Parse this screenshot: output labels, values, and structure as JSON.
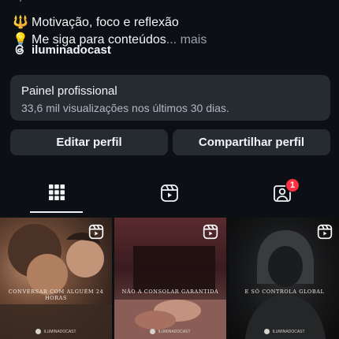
{
  "bio": {
    "line0": "⚙ — —",
    "line1_emoji": "🔱",
    "line1_text": "Motivação, foco e reflexão",
    "line2_emoji": "💡",
    "line2_text": "Me siga para conteúdos",
    "more_label": "... mais"
  },
  "threads": {
    "handle": "iluminadocast",
    "icon": "threads-icon"
  },
  "panel": {
    "title": "Painel profissional",
    "subtitle": "33,6 mil visualizações nos últimos 30 dias."
  },
  "buttons": {
    "edit": "Editar perfil",
    "share": "Compartilhar perfil"
  },
  "tabs": {
    "grid_icon": "grid-icon",
    "reels_icon": "reels-icon",
    "tagged_icon": "tagged-icon",
    "tagged_badge": "1"
  },
  "posts": [
    {
      "caption": "CONVERSAR COM ALGUÉM 24 HORAS",
      "brand": "ILUMINADOCAST",
      "icon": "reels-icon"
    },
    {
      "caption": "NÃO A CONSOLAR GARANTIDA",
      "brand": "ILUMINADOCAST",
      "icon": "reels-icon"
    },
    {
      "caption": "E SÓ CONTROLA GLOBAL",
      "brand": "ILUMINADOCAST",
      "icon": "reels-icon"
    }
  ],
  "colors": {
    "background": "#0c0f14",
    "card": "#262a31",
    "badge": "#ff3040"
  }
}
